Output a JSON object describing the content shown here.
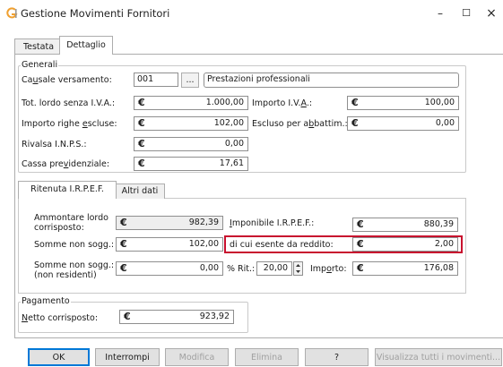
{
  "window": {
    "title": "Gestione Movimenti Fornitori",
    "minimize": "–",
    "maximize": "☐",
    "close": "×"
  },
  "tabs": [
    {
      "label": "Testata"
    },
    {
      "label": "Dettaglio"
    }
  ],
  "generali": {
    "title": "Generali",
    "causale_label": "Causale versamento:",
    "causale_code": "001",
    "causale_browse": "...",
    "causale_desc": "Prestazioni professionali",
    "tot_lordo_label": "Tot. lordo senza I.V.A.:",
    "tot_lordo_value": "1.000,00",
    "importo_iva_label": "Importo I.V.A.:",
    "importo_iva_value": "100,00",
    "righe_escluse_label": "Importo righe escluse:",
    "righe_escluse_value": "102,00",
    "escluso_abbatt_label": "Escluso per abbattim.:",
    "escluso_abbatt_value": "0,00",
    "rivalsa_label": "Rivalsa I.N.P.S.:",
    "rivalsa_value": "0,00",
    "cassa_label": "Cassa previdenziale:",
    "cassa_value": "17,61",
    "currency": "€"
  },
  "subtabs": [
    {
      "label": "Ritenuta I.R.P.E.F."
    },
    {
      "label": "Altri dati"
    }
  ],
  "irpef": {
    "ammontare_label_1": "Ammontare lordo",
    "ammontare_label_2": "corrisposto:",
    "ammontare_value": "982,39",
    "imponibile_label": "Imponibile I.R.P.E.F.:",
    "imponibile_value": "880,39",
    "somme_non_sogg_label": "Somme non sogg.:",
    "somme_non_sogg_value": "102,00",
    "esente_label": "di cui esente da reddito:",
    "esente_value": "2,00",
    "somme_nr_label_1": "Somme non sogg.:",
    "somme_nr_label_2": "(non residenti)",
    "somme_nr_value": "0,00",
    "rit_label": "% Rit.:",
    "rit_value": "20,00",
    "importo_label": "Importo:",
    "importo_value": "176,08"
  },
  "pagamento": {
    "title": "Pagamento",
    "netto_label": "Netto corrisposto:",
    "netto_value": "923,92"
  },
  "buttons": {
    "ok": "OK",
    "interrompi": "Interrompi",
    "modifica": "Modifica",
    "elimina": "Elimina",
    "help": "?",
    "visualizza": "Visualizza tutti i movimenti..."
  },
  "colors": {
    "highlight": "#c8102e",
    "app_icon": "#f0a030",
    "focus": "#0078d7"
  }
}
